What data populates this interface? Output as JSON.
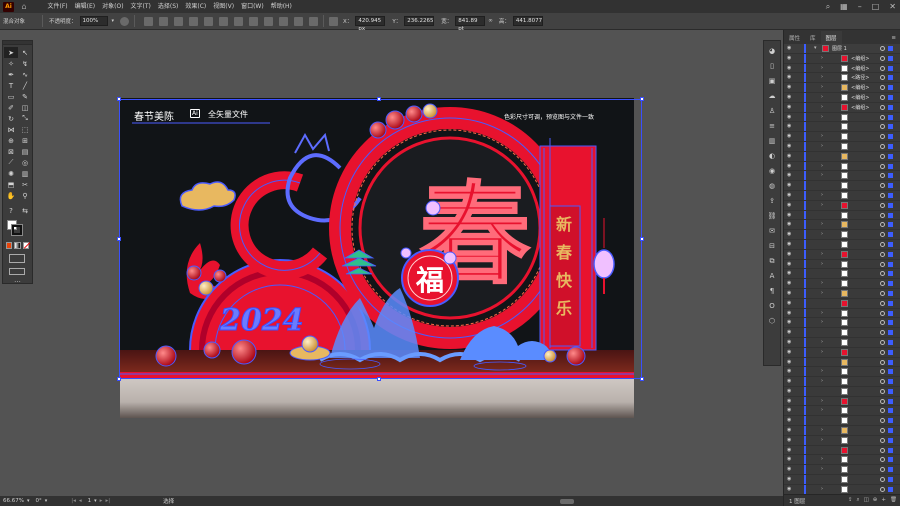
{
  "menubar": {
    "logo": "Ai",
    "items": [
      "文件(F)",
      "编辑(E)",
      "对象(O)",
      "文字(T)",
      "选择(S)",
      "效果(C)",
      "视图(V)",
      "窗口(W)",
      "帮助(H)"
    ]
  },
  "controlbar": {
    "selection_label": "混合对象",
    "opacity_label": "不透明度：",
    "opacity_value": "100%",
    "x_label": "X：",
    "x_value": "420.945 px",
    "y_label": "Y：",
    "y_value": "236.2265",
    "w_label": "宽：",
    "w_value": "841.89 pt",
    "h_label": "高：",
    "h_value": "441.8077"
  },
  "artwork": {
    "title": "春节美陈",
    "ai_badge": "Ai",
    "subtitle": "全矢量文件",
    "note": "色彩尺寸可调，预览图与文件一致",
    "big_char": "春",
    "fu_char": "福",
    "year_text": "2024",
    "banner_chars": [
      "新",
      "春",
      "快",
      "乐"
    ]
  },
  "layers_panel": {
    "tabs": [
      "属性",
      "库",
      "图层"
    ],
    "active_tab": "图层",
    "top_layer": "图层 1",
    "rows": [
      "<编组>",
      "<编组>",
      "<路径>",
      "<编组>",
      "<编组>",
      "<编组>"
    ],
    "footer_label": "1 图层"
  },
  "statusbar": {
    "zoom": "66.67%",
    "rotation": "0°",
    "artboard_num": "1",
    "mode": "选择"
  },
  "colors": {
    "accent_red": "#e8122e",
    "stroke_blue": "#4a5bff",
    "gold": "#e8b860"
  }
}
